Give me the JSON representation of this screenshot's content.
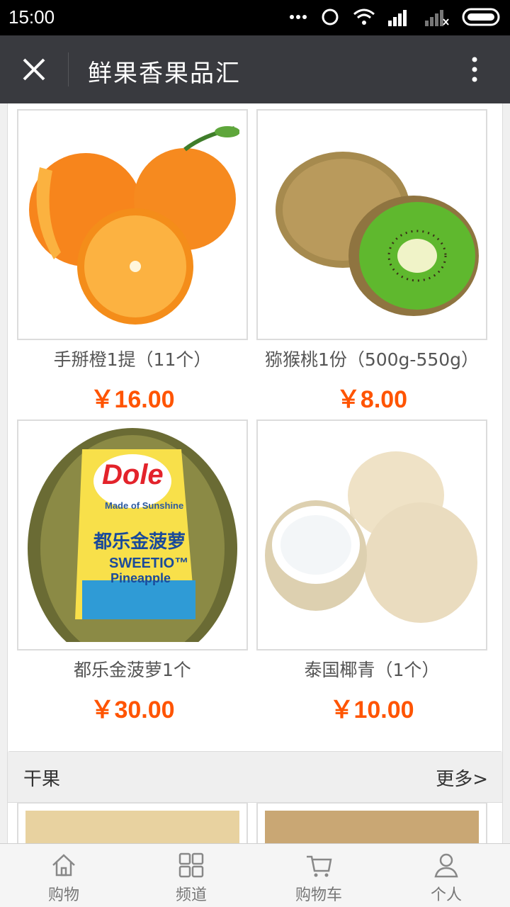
{
  "status": {
    "time": "15:00"
  },
  "header": {
    "title": "鲜果香果品汇"
  },
  "products": [
    {
      "name": "手掰橙1提（11个）",
      "price": "￥16.00",
      "image": "orange"
    },
    {
      "name": "猕猴桃1份（500g-550g）",
      "price": "￥8.00",
      "image": "kiwi"
    },
    {
      "name": "都乐金菠萝1个",
      "price": "￥30.00",
      "image": "pineapple"
    },
    {
      "name": "泰国椰青（1个）",
      "price": "￥10.00",
      "image": "coconut"
    }
  ],
  "pineapple_label": {
    "brand": "Dole",
    "tagline": "Made of Sunshine",
    "cn": "都乐金菠萝",
    "en1": "SWEETIO™",
    "en2": "Pineapple"
  },
  "section": {
    "title": "干果",
    "more": "更多>"
  },
  "tabs": [
    {
      "label": "购物",
      "icon": "home-icon"
    },
    {
      "label": "频道",
      "icon": "grid-icon"
    },
    {
      "label": "购物车",
      "icon": "cart-icon"
    },
    {
      "label": "个人",
      "icon": "person-icon"
    }
  ],
  "colors": {
    "price": "#ff5400",
    "titlebar": "#393a3f"
  }
}
